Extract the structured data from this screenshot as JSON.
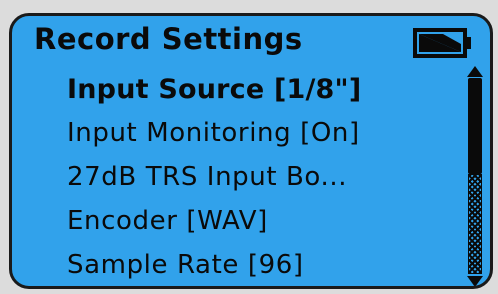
{
  "header": {
    "title": "Record Settings",
    "battery_icon": "battery-icon"
  },
  "menu": {
    "items": [
      {
        "label": "Input Source [1/8\"]",
        "selected": true
      },
      {
        "label": "Input Monitoring [On]",
        "selected": false
      },
      {
        "label": "27dB TRS Input Bo...",
        "selected": false
      },
      {
        "label": "Encoder [WAV]",
        "selected": false
      },
      {
        "label": "Sample Rate [96]",
        "selected": false
      }
    ]
  },
  "scrollbar": {
    "position_fraction": 0.0,
    "visible_fraction": 0.45
  },
  "colors": {
    "screen_background": "#31a2eb",
    "text": "#0a0a0a",
    "frame": "#1a1a1a"
  }
}
